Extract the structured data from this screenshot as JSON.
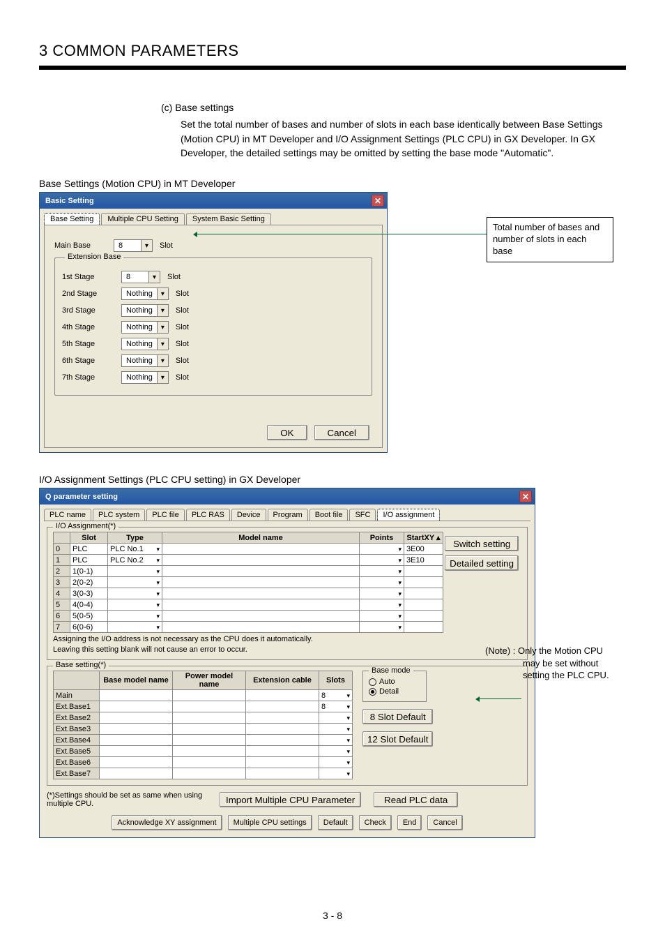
{
  "chapter": "3  COMMON PARAMETERS",
  "body": {
    "sublabel": "(c)  Base settings",
    "text": "Set the total number of bases and number of slots in each base identically between Base Settings (Motion CPU) in MT Developer and I/O Assignment Settings (PLC CPU) in GX Developer. In GX Developer, the detailed settings may be omitted by setting the base mode \"Automatic\"."
  },
  "caption1": "Base Settings (Motion CPU) in MT Developer",
  "dlg1": {
    "title": "Basic Setting",
    "tabs": [
      "Base Setting",
      "Multiple CPU Setting",
      "System Basic Setting"
    ],
    "main_label": "Main Base",
    "main_value": "8",
    "slot_label": "Slot",
    "ext_group": "Extension Base",
    "stages": [
      {
        "label": "1st Stage",
        "value": "8"
      },
      {
        "label": "2nd Stage",
        "value": "Nothing"
      },
      {
        "label": "3rd Stage",
        "value": "Nothing"
      },
      {
        "label": "4th Stage",
        "value": "Nothing"
      },
      {
        "label": "5th Stage",
        "value": "Nothing"
      },
      {
        "label": "6th Stage",
        "value": "Nothing"
      },
      {
        "label": "7th Stage",
        "value": "Nothing"
      }
    ],
    "ok": "OK",
    "cancel": "Cancel"
  },
  "callout1": "Total number of bases and number of slots in each base",
  "caption2": "I/O Assignment Settings (PLC CPU setting) in GX Developer",
  "dlg2": {
    "title": "Q parameter setting",
    "tabs": [
      "PLC name",
      "PLC system",
      "PLC file",
      "PLC RAS",
      "Device",
      "Program",
      "Boot file",
      "SFC",
      "I/O assignment"
    ],
    "fieldset1_legend": "I/O Assignment(*)",
    "io_headers": [
      "",
      "Slot",
      "Type",
      "Model name",
      "Points",
      "StartXY"
    ],
    "io_rows": [
      {
        "idx": "0",
        "slot": "PLC",
        "type": "PLC No.1",
        "model": "",
        "points": "",
        "start": "3E00"
      },
      {
        "idx": "1",
        "slot": "PLC",
        "type": "PLC No.2",
        "model": "",
        "points": "",
        "start": "3E10"
      },
      {
        "idx": "2",
        "slot": "1(0-1)",
        "type": "",
        "model": "",
        "points": "",
        "start": ""
      },
      {
        "idx": "3",
        "slot": "2(0-2)",
        "type": "",
        "model": "",
        "points": "",
        "start": ""
      },
      {
        "idx": "4",
        "slot": "3(0-3)",
        "type": "",
        "model": "",
        "points": "",
        "start": ""
      },
      {
        "idx": "5",
        "slot": "4(0-4)",
        "type": "",
        "model": "",
        "points": "",
        "start": ""
      },
      {
        "idx": "6",
        "slot": "5(0-5)",
        "type": "",
        "model": "",
        "points": "",
        "start": ""
      },
      {
        "idx": "7",
        "slot": "6(0-6)",
        "type": "",
        "model": "",
        "points": "",
        "start": ""
      }
    ],
    "switch_btn": "Switch setting",
    "detailed_btn": "Detailed setting",
    "io_note1": "Assigning the I/O address is not necessary as the CPU does it automatically.",
    "io_note2": "Leaving this setting blank will not cause an error to occur.",
    "fieldset2_legend": "Base setting(*)",
    "base_headers": [
      "",
      "Base model name",
      "Power model name",
      "Extension cable",
      "Slots"
    ],
    "base_rows": [
      {
        "label": "Main",
        "slots": "8"
      },
      {
        "label": "Ext.Base1",
        "slots": "8"
      },
      {
        "label": "Ext.Base2",
        "slots": ""
      },
      {
        "label": "Ext.Base3",
        "slots": ""
      },
      {
        "label": "Ext.Base4",
        "slots": ""
      },
      {
        "label": "Ext.Base5",
        "slots": ""
      },
      {
        "label": "Ext.Base6",
        "slots": ""
      },
      {
        "label": "Ext.Base7",
        "slots": ""
      }
    ],
    "basemode_title": "Base mode",
    "radio_auto": "Auto",
    "radio_detail": "Detail",
    "btn_8slot": "8 Slot Default",
    "btn_12slot": "12 Slot Default",
    "footnote": "(*)Settings should be set as same when using multiple CPU.",
    "btn_import": "Import Multiple CPU Parameter",
    "btn_readplc": "Read PLC data",
    "footer_btns": [
      "Acknowledge XY assignment",
      "Multiple CPU settings",
      "Default",
      "Check",
      "End",
      "Cancel"
    ]
  },
  "note2_a": "(Note) : Only the Motion CPU",
  "note2_b": "may be set without",
  "note2_c": "setting the PLC CPU.",
  "page_number": "3 - 8"
}
